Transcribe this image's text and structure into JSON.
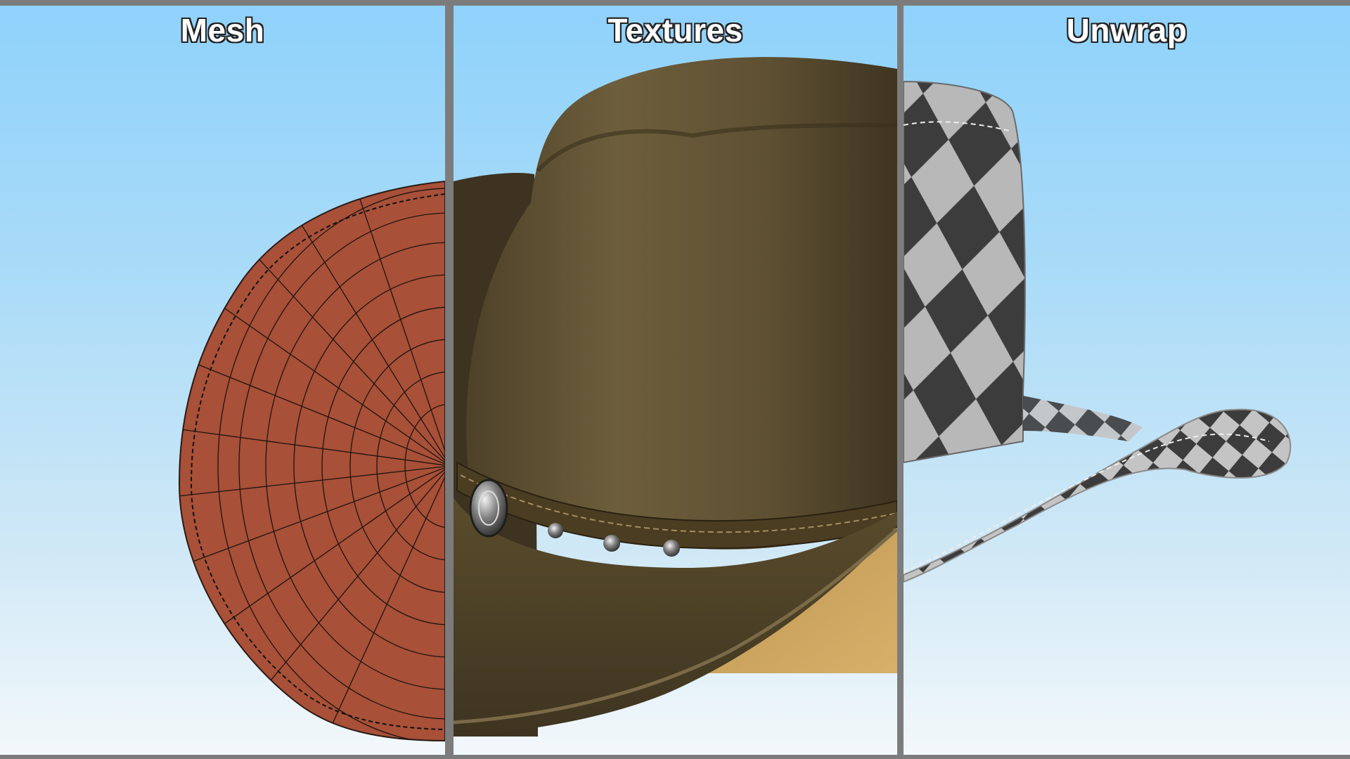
{
  "panels": [
    {
      "title": "Mesh",
      "icon": "wireframe-hat-icon"
    },
    {
      "title": "Textures",
      "icon": "textured-hat-icon"
    },
    {
      "title": "Unwrap",
      "icon": "checker-hat-icon"
    }
  ],
  "colors": {
    "frame": "#7c7c7c",
    "sky_top": "#8fd2fb",
    "sky_bottom": "#f3f8fb",
    "mesh_fill": "#a85038",
    "leather": "#6a5a38",
    "checker_dark": "#3c3c3c",
    "checker_light": "#b8b8b8"
  }
}
